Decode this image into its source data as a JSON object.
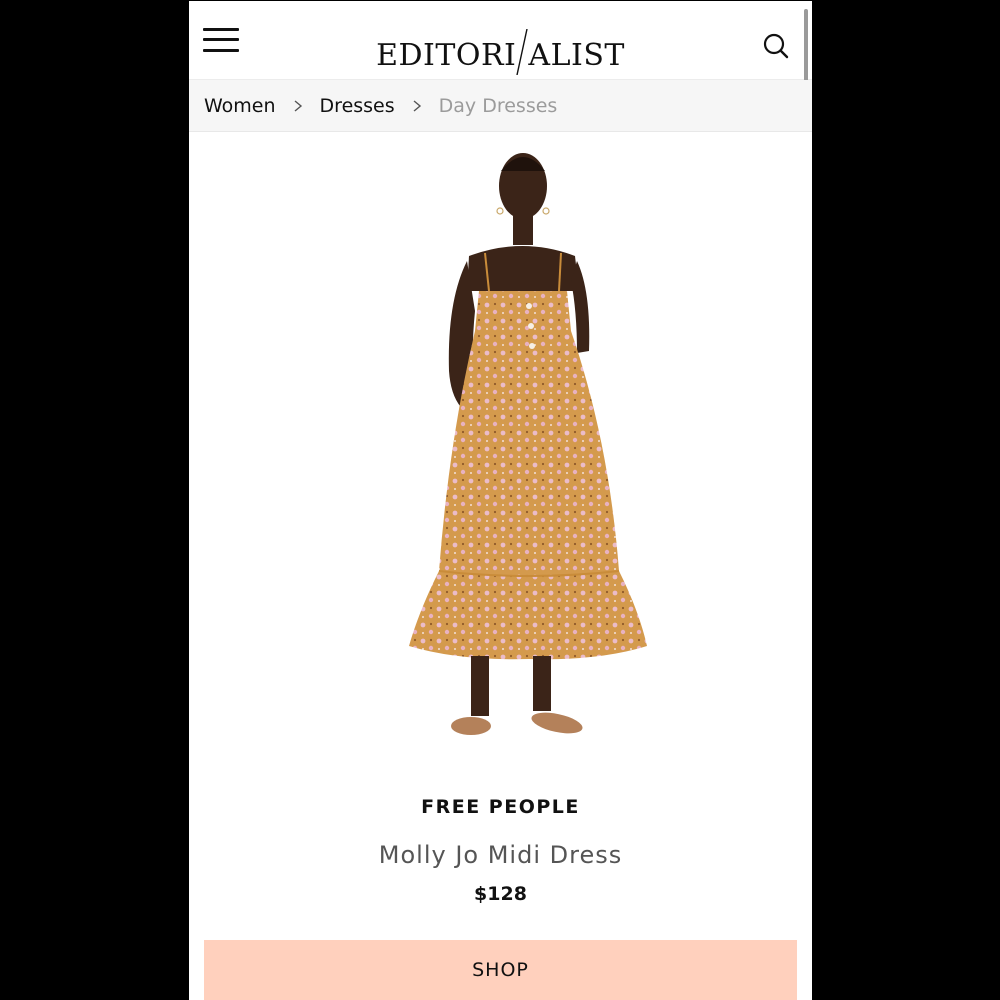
{
  "header": {
    "logo_text": "EDITORIALIST",
    "logo_left": "EDITORI",
    "logo_right": "ALIST"
  },
  "breadcrumb": {
    "items": [
      {
        "label": "Women"
      },
      {
        "label": "Dresses"
      },
      {
        "label": "Day Dresses"
      }
    ]
  },
  "product": {
    "brand": "FREE PEOPLE",
    "name": "Molly Jo Midi Dress",
    "price": "$128",
    "shop_label": "SHOP",
    "dress_color": "#d39a4e",
    "flower_color": "#e9b7c6"
  },
  "icons": {
    "menu": "hamburger-menu-icon",
    "search": "search-icon",
    "separator": "chevron-right-icon"
  }
}
